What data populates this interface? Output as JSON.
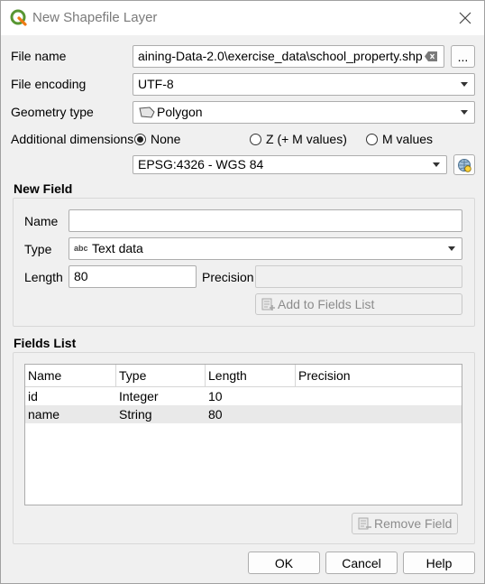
{
  "window": {
    "title": "New Shapefile Layer",
    "close_icon": "close-icon",
    "app_icon": "qgis-logo-icon"
  },
  "form": {
    "file_name_label": "File name",
    "file_name_value": "aining-Data-2.0\\exercise_data\\school_property.shp",
    "browse_label": "...",
    "file_encoding_label": "File encoding",
    "file_encoding_value": "UTF-8",
    "geometry_type_label": "Geometry type",
    "geometry_type_value": "Polygon",
    "additional_dimensions_label": "Additional dimensions",
    "dimensions": [
      {
        "label": "None",
        "selected": true
      },
      {
        "label": "Z (+ M values)",
        "selected": false
      },
      {
        "label": "M values",
        "selected": false
      }
    ],
    "crs_value": "EPSG:4326 - WGS 84"
  },
  "new_field": {
    "title": "New Field",
    "name_label": "Name",
    "name_value": "",
    "type_label": "Type",
    "type_icon_text": "abc",
    "type_value": "Text data",
    "length_label": "Length",
    "length_value": "80",
    "precision_label": "Precision",
    "precision_value": "",
    "add_button_label": "Add to Fields List"
  },
  "fields_list": {
    "title": "Fields List",
    "columns": [
      "Name",
      "Type",
      "Length",
      "Precision"
    ],
    "rows": [
      [
        "id",
        "Integer",
        "10",
        ""
      ],
      [
        "name",
        "String",
        "80",
        ""
      ]
    ],
    "remove_button_label": "Remove Field"
  },
  "buttons": {
    "ok": "OK",
    "cancel": "Cancel",
    "help": "Help"
  }
}
